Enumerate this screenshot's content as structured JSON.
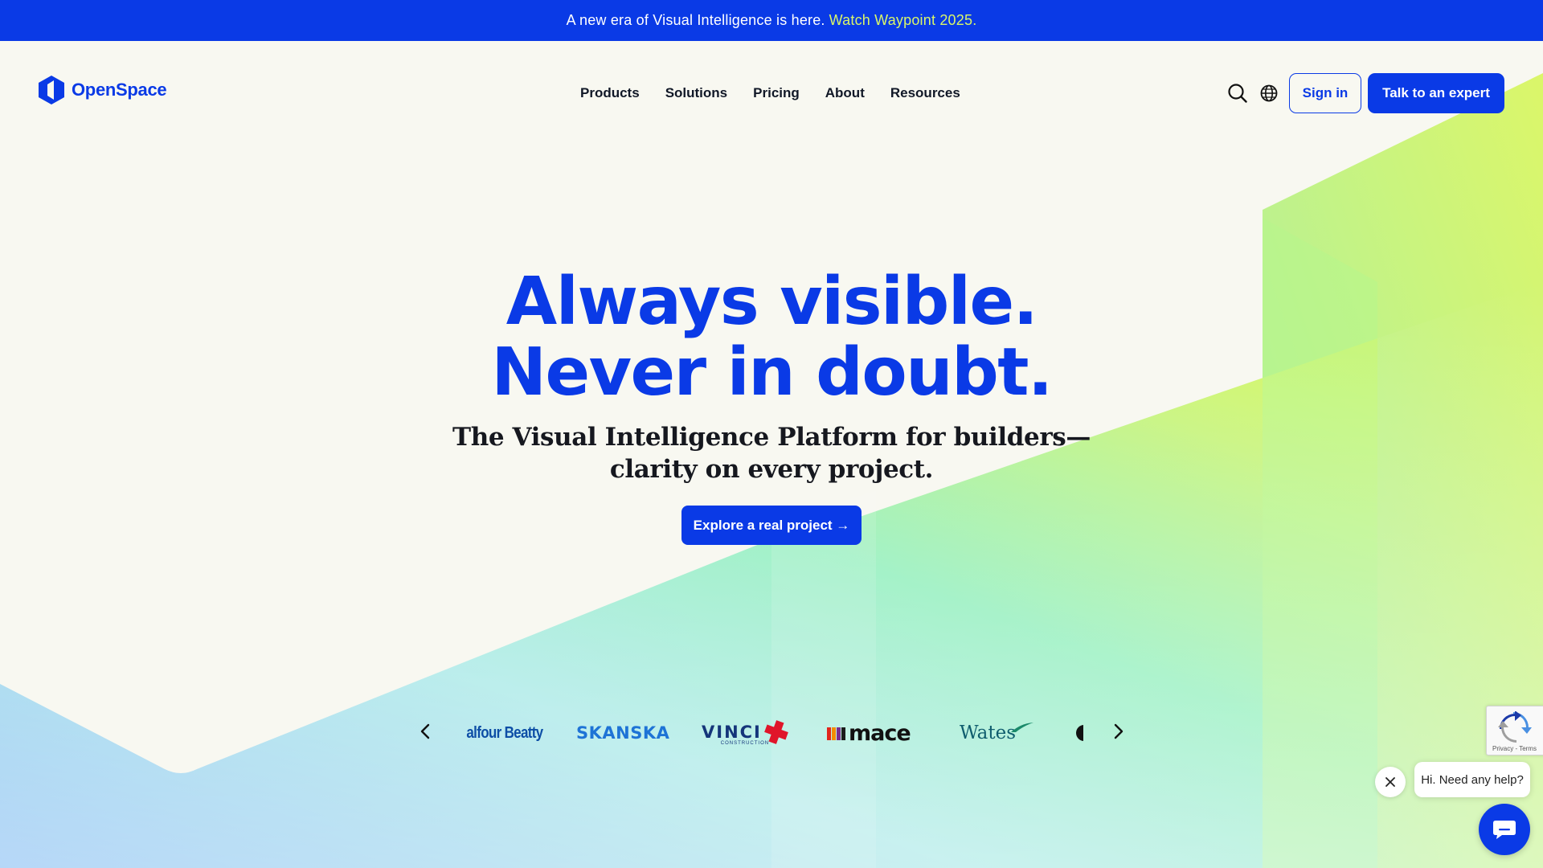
{
  "announcement": {
    "text": "A new era of Visual Intelligence is here.",
    "link": "Watch Waypoint 2025."
  },
  "header": {
    "brand": "OpenSpace",
    "nav": [
      "Products",
      "Solutions",
      "Pricing",
      "About",
      "Resources"
    ],
    "icons": [
      "search-icon",
      "globe-icon"
    ],
    "sign_in": "Sign in",
    "cta": "Talk to an expert"
  },
  "hero": {
    "title_line1": "Always visible.",
    "title_line2": "Never in doubt.",
    "subtitle_line1": "The Visual Intelligence Platform for builders—",
    "subtitle_line2": "clarity on every project.",
    "cta": "Explore a real project →"
  },
  "clients": {
    "logos": [
      "alfour Beatty",
      "SKANSKA",
      "VINCI",
      "CONSTRUCTION",
      "mace",
      "Wates"
    ]
  },
  "recaptcha": {
    "footer": "Privacy - Terms"
  },
  "chat": {
    "greeting": "Hi. Need any help?"
  },
  "colors": {
    "brand_blue": "#0a3ae6",
    "announce_link": "#d8f56a",
    "page_bg": "#f8f8f1"
  }
}
